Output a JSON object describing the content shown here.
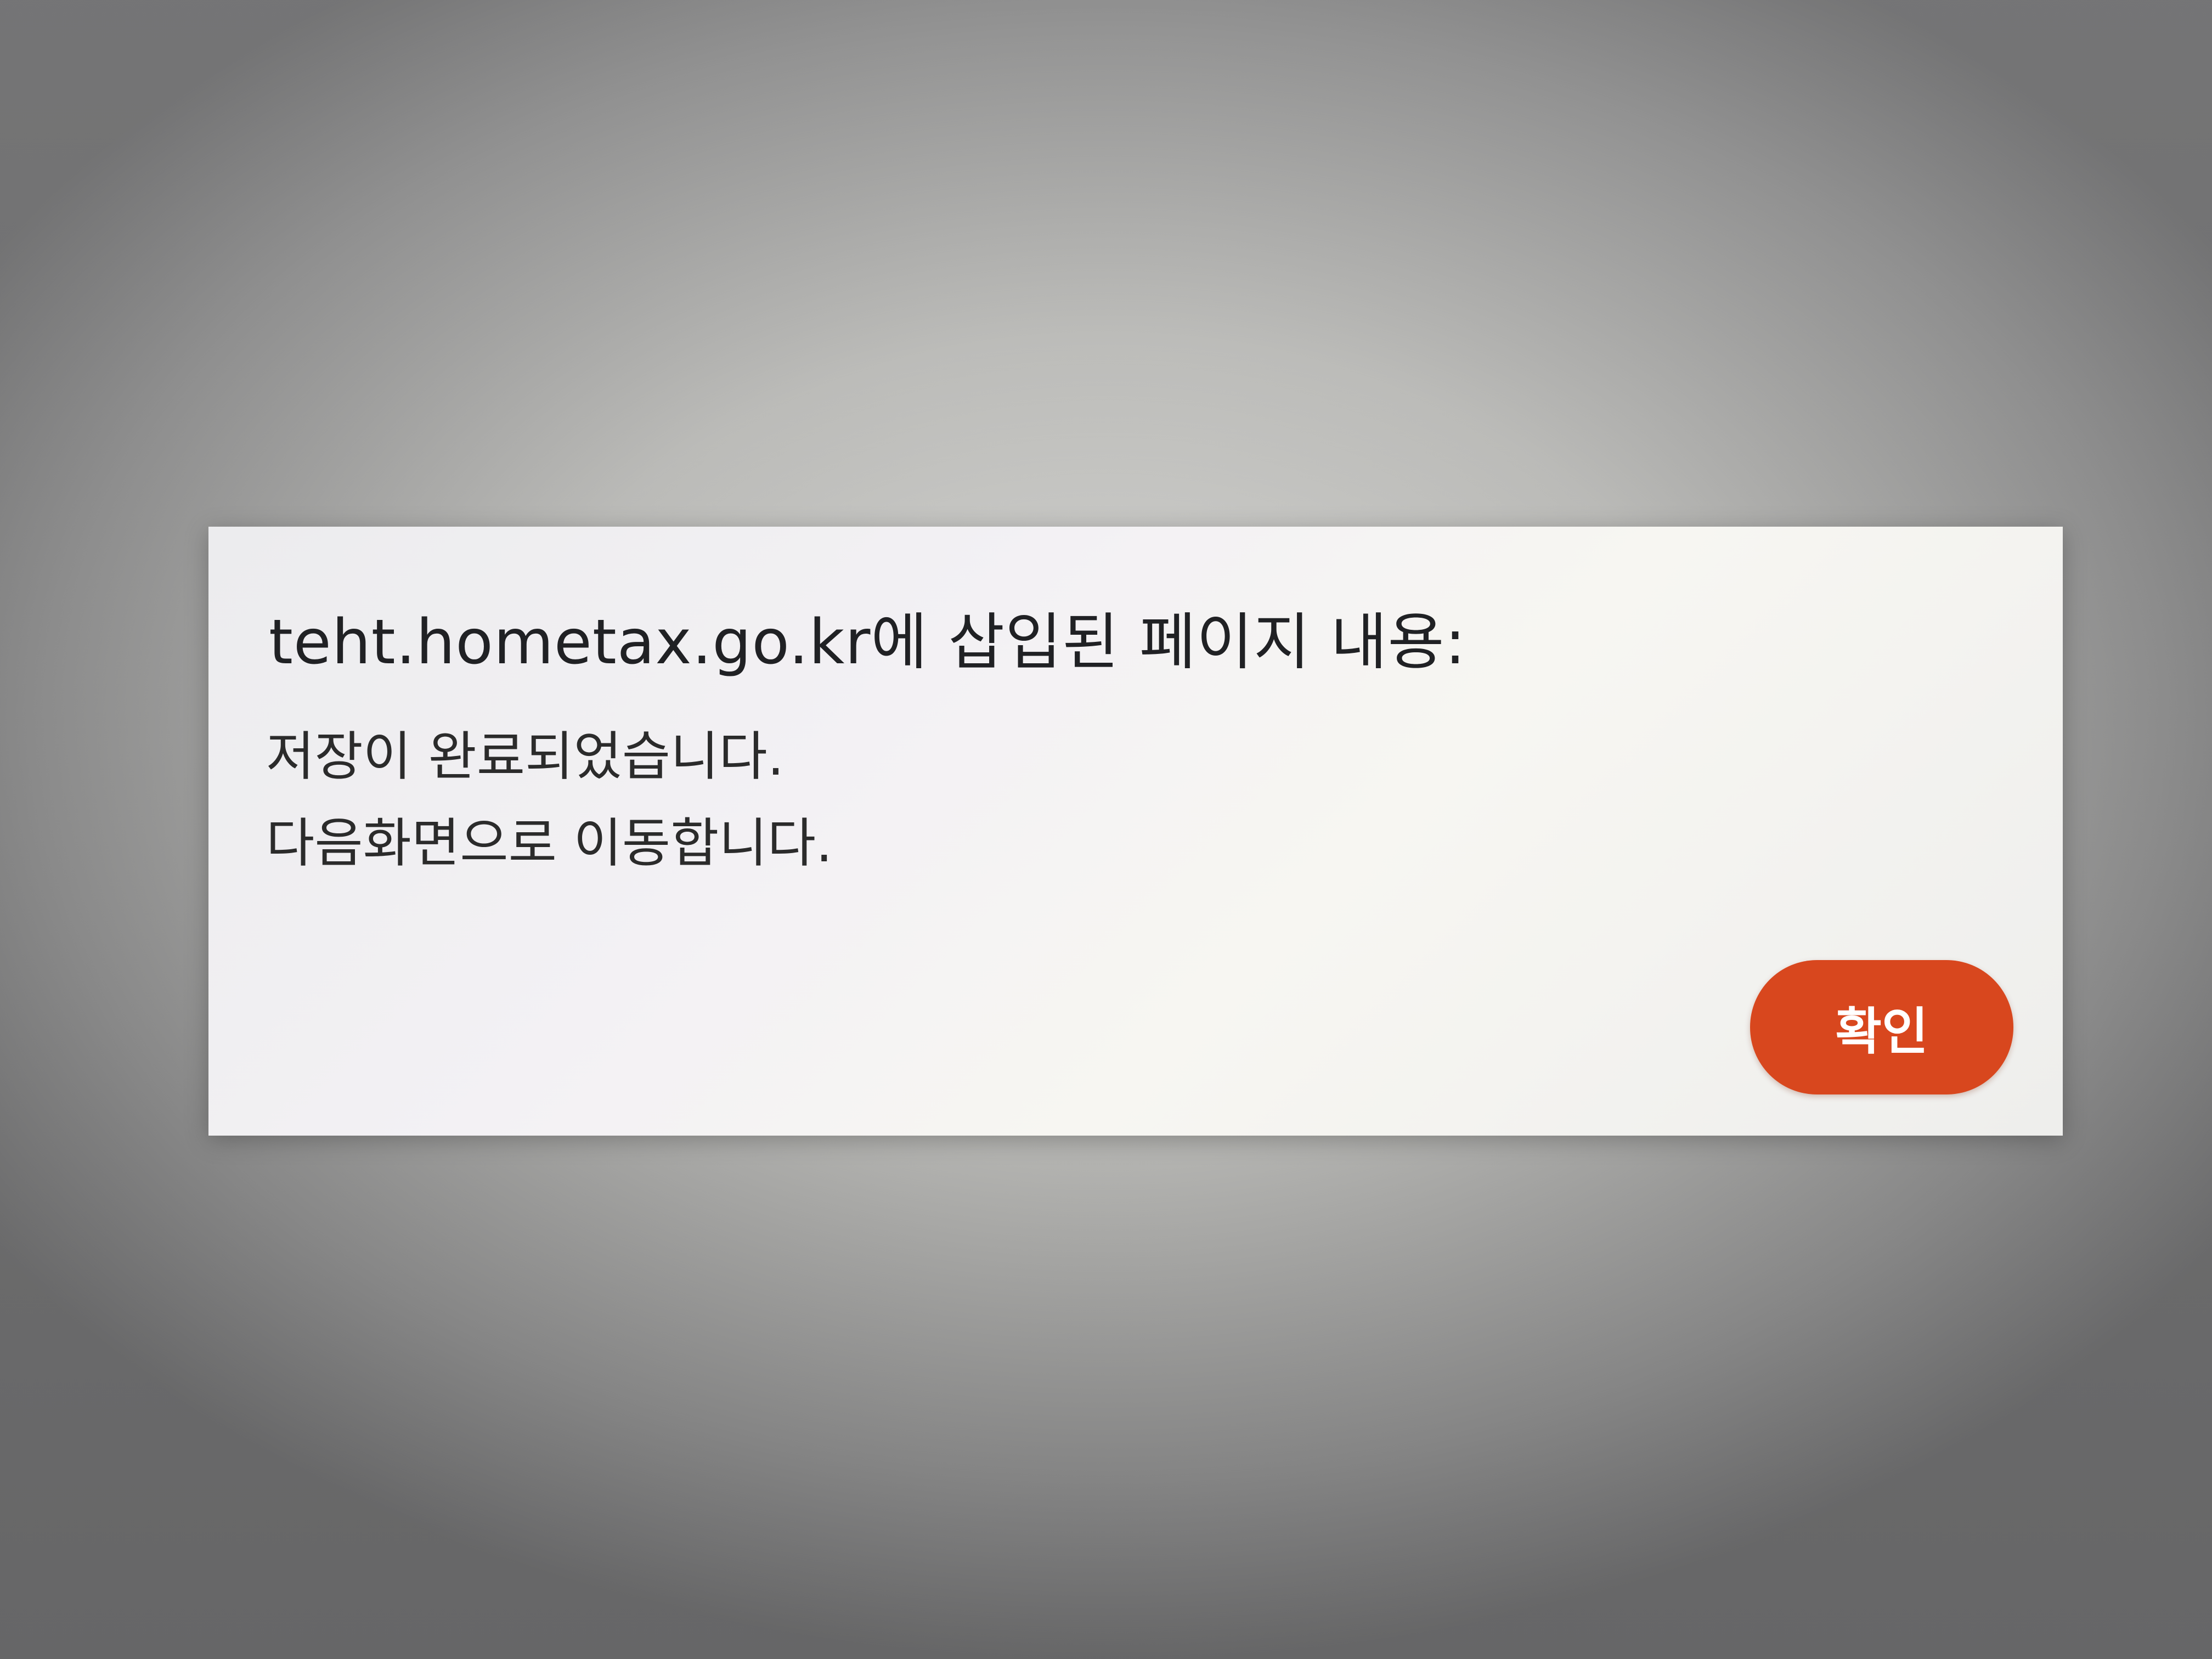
{
  "dialog": {
    "title": "teht.hometax.go.kr에 삽입된 페이지 내용:",
    "message_lines": [
      "저장이 완료되었습니다.",
      "다음화면으로 이동합니다."
    ],
    "confirm_label": "확인"
  },
  "colors": {
    "confirm_button": "#d8471e",
    "dialog_background": "#f2f1f2"
  }
}
